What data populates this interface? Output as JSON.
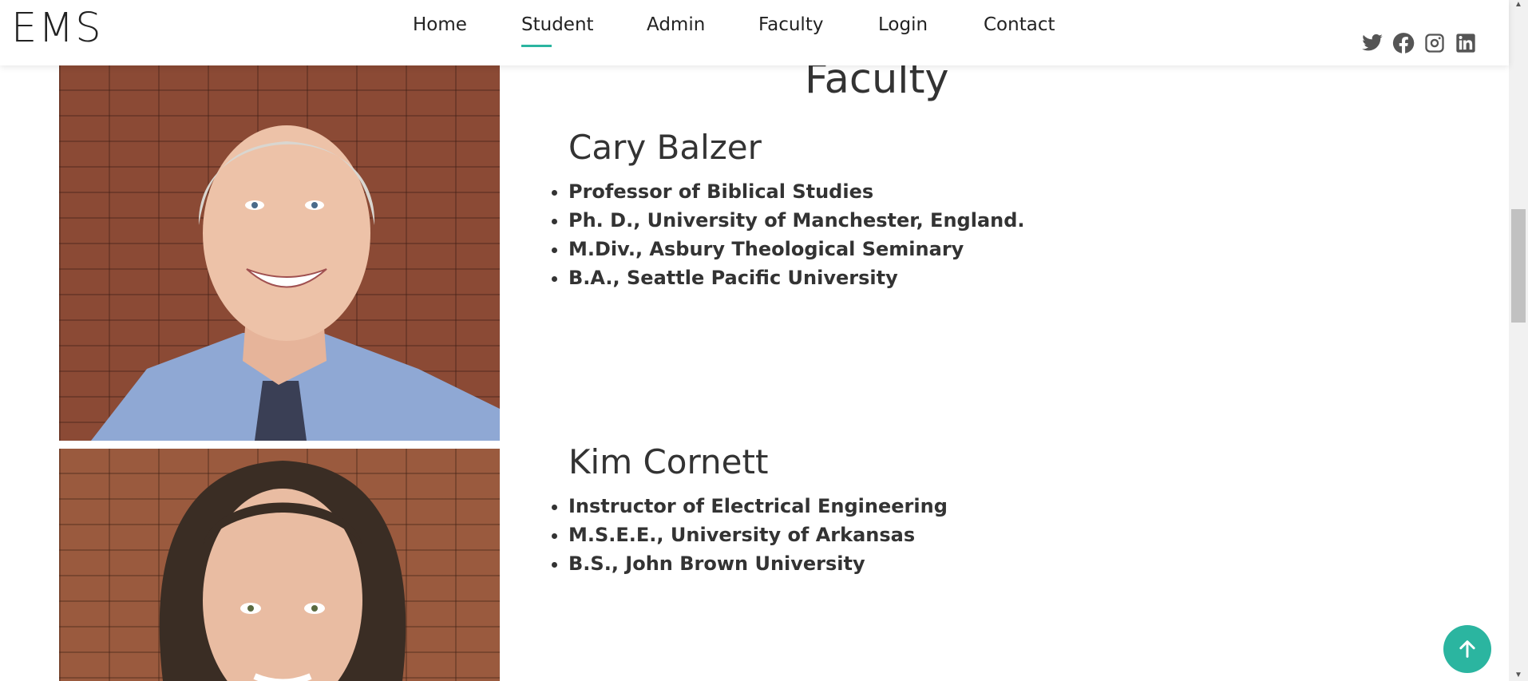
{
  "header": {
    "logo": "EMS",
    "nav": [
      {
        "label": "Home"
      },
      {
        "label": "Student",
        "active": true
      },
      {
        "label": "Admin"
      },
      {
        "label": "Faculty"
      },
      {
        "label": "Login"
      },
      {
        "label": "Contact"
      }
    ],
    "social_icons": [
      "twitter-icon",
      "facebook-icon",
      "instagram-icon",
      "linkedin-icon"
    ]
  },
  "main": {
    "section_title": "Faculty",
    "people": [
      {
        "name": "Cary Balzer",
        "credentials": [
          "Professor of Biblical Studies",
          "Ph. D., University of Manchester, England.",
          "M.Div., Asbury Theological Seminary",
          "B.A., Seattle Pacific University"
        ]
      },
      {
        "name": "Kim Cornett",
        "credentials": [
          "Instructor of Electrical Engineering",
          "M.S.E.E., University of Arkansas",
          "B.S., John Brown University"
        ]
      }
    ]
  },
  "colors": {
    "accent": "#2bb5a0",
    "text": "#333333",
    "icon": "#555555"
  }
}
